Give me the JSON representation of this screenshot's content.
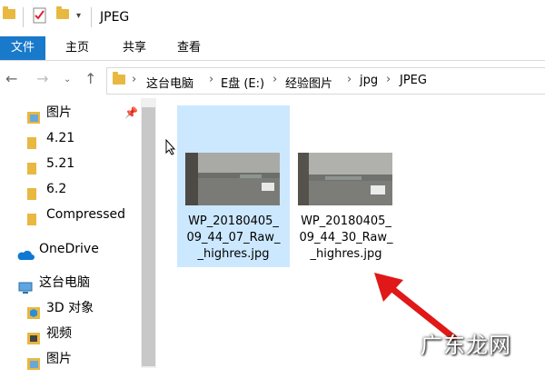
{
  "window": {
    "title": "JPEG"
  },
  "ribbon": {
    "tabs": [
      "文件",
      "主页",
      "共享",
      "查看"
    ]
  },
  "address": {
    "crumbs": [
      "这台电脑",
      "E盘 (E:)",
      "经验图片",
      "jpg",
      "JPEG"
    ]
  },
  "sidebar": {
    "items": [
      {
        "label": "图片",
        "icon": "pictures-folder-icon",
        "pinned": true
      },
      {
        "label": "4.21",
        "icon": "folder-icon"
      },
      {
        "label": "5.21",
        "icon": "folder-icon"
      },
      {
        "label": "6.2",
        "icon": "folder-icon"
      },
      {
        "label": "Compressed",
        "icon": "folder-icon"
      },
      {
        "label": "OneDrive",
        "icon": "onedrive-icon"
      },
      {
        "label": "这台电脑",
        "icon": "computer-icon"
      },
      {
        "label": "3D 对象",
        "icon": "3d-objects-icon"
      },
      {
        "label": "视频",
        "icon": "video-folder-icon"
      },
      {
        "label": "图片",
        "icon": "pictures-folder-icon"
      }
    ]
  },
  "files": [
    {
      "name_lines": [
        "WP_20180405_",
        "09_44_07_Raw_",
        "_highres.jpg"
      ],
      "selected": true
    },
    {
      "name_lines": [
        "WP_20180405_",
        "09_44_30_Raw_",
        "_highres.jpg"
      ],
      "selected": false
    }
  ],
  "watermark": "广东龙网",
  "colors": {
    "accent": "#1979ca",
    "selection": "#cce8ff",
    "arrow": "#e01818",
    "folder": "#e8b840"
  }
}
